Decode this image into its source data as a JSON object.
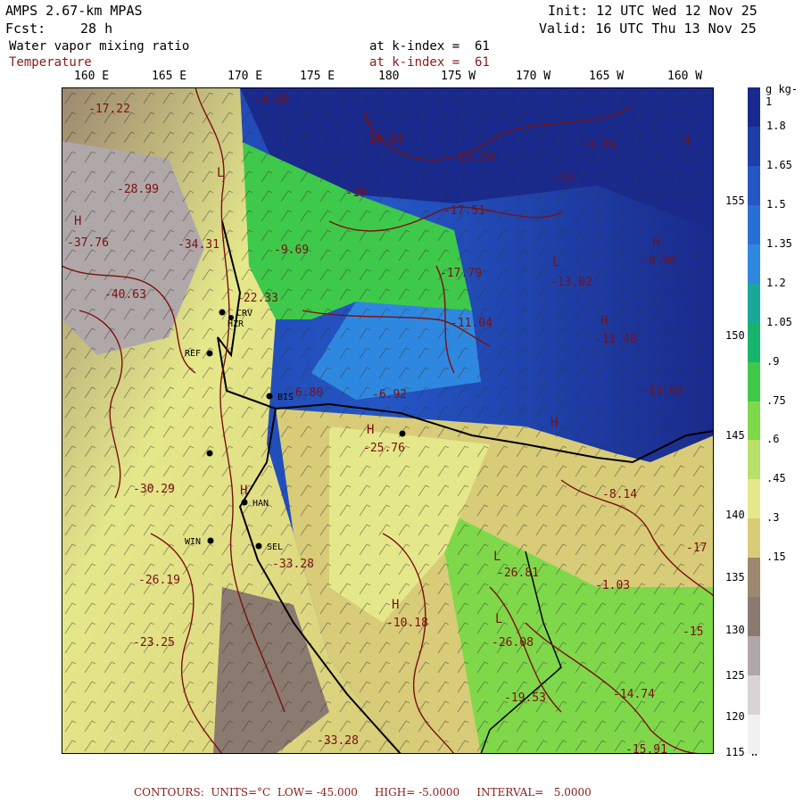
{
  "header": {
    "model": "AMPS 2.67-km MPAS",
    "fcst_label": "Fcst:",
    "fcst_value": "28 h",
    "init": "Init: 12 UTC Wed 12 Nov 25",
    "valid": "Valid: 16 UTC Thu 13 Nov 25",
    "field1": "Water vapor mixing ratio",
    "field1_level": "at k-index =  61",
    "field2": "Temperature",
    "field2_level": "at k-index =  61"
  },
  "longitude_labels": [
    "160 E",
    "165 E",
    "170 E",
    "175 E",
    "180",
    "175 W",
    "170 W",
    "165 W",
    "160 W"
  ],
  "latitude_labels": [
    "155",
    "150",
    "145",
    "140",
    "135",
    "130",
    "125",
    "120",
    "115"
  ],
  "lat_suffix": "W",
  "colorbar": {
    "unit": "g kg-1",
    "labels": [
      "1.8",
      "1.65",
      "1.5",
      "1.35",
      "1.2",
      "1.05",
      ".9",
      ".75",
      ".6",
      ".45",
      ".3",
      ".15"
    ],
    "colors": [
      "#1a2a8c",
      "#1e3fa8",
      "#2456c4",
      "#2a6fd8",
      "#2f88e0",
      "#1aa89a",
      "#17b56c",
      "#3fc94a",
      "#7fd84a",
      "#b8e06a",
      "#e5e88a",
      "#d8cc78",
      "#9c8870",
      "#8a7a70",
      "#b0a8a8",
      "#d8d4d4",
      "#f2f0f0"
    ]
  },
  "map": {
    "station_labels": [
      "CRV",
      "REF",
      "BIS",
      "WIN",
      "SEL",
      "HAN",
      "HZR"
    ],
    "contour_values": [
      "-17.22",
      "-4.58",
      "-10.69",
      "-9.06",
      "-10.24",
      "-10",
      "-10",
      "-28.99",
      "-37.76",
      "-34.31",
      "-40.63",
      "-9.69",
      "-22.33",
      "-17.51",
      "-17.79",
      "-13.02",
      "-9.96",
      "-11.04",
      "-11.48",
      "-6.80",
      "-6.92",
      "-13.65",
      "-25.76",
      "-30.29",
      "-26.19",
      "-23.25",
      "-33.28",
      "-33.28",
      "-10.18",
      "-26.81",
      "-26.08",
      "-19.53",
      "-14.74",
      "-8.14",
      "-15.91",
      "-1.03",
      "-15",
      "-17"
    ],
    "extreme_markers": [
      "H",
      "L"
    ]
  },
  "footer": "CONTOURS:  UNITS=°C  LOW= -45.000     HIGH= -5.0000     INTERVAL=   5.0000"
}
